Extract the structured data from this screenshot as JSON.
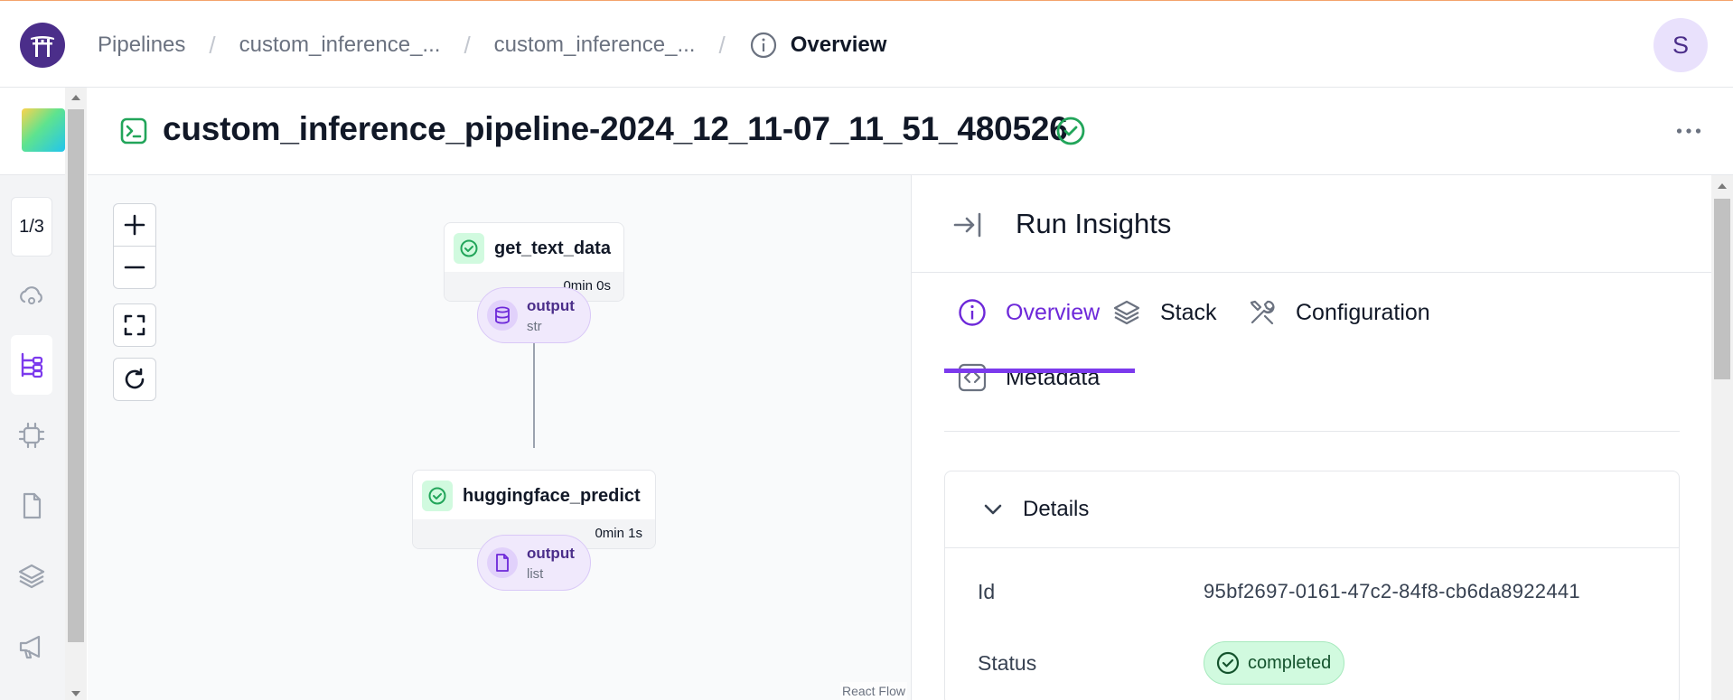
{
  "header": {
    "breadcrumbs": [
      "Pipelines",
      "custom_inference_...",
      "custom_inference_..."
    ],
    "current": "Overview",
    "avatar_initial": "S"
  },
  "rail": {
    "counter": "1/3",
    "icons": [
      "cloud-icon",
      "pipeline-icon",
      "chip-icon",
      "document-icon",
      "stack-icon",
      "megaphone-icon"
    ]
  },
  "run": {
    "title": "custom_inference_pipeline-2024_12_11-07_11_51_480526",
    "status": "completed"
  },
  "dag": {
    "steps": [
      {
        "name": "get_text_data",
        "duration": "0min 0s"
      },
      {
        "name": "huggingface_predict",
        "duration": "0min 1s"
      }
    ],
    "artifacts": [
      {
        "name": "output",
        "type": "str"
      },
      {
        "name": "output",
        "type": "list"
      }
    ],
    "attribution": "React Flow"
  },
  "panel": {
    "title": "Run Insights",
    "tabs": [
      "Overview",
      "Stack",
      "Configuration",
      "Metadata"
    ],
    "active_tab": "Overview",
    "details": {
      "title": "Details",
      "id_label": "Id",
      "id_value": "95bf2697-0161-47c2-84f8-cb6da8922441",
      "status_label": "Status",
      "status_value": "completed"
    }
  },
  "colors": {
    "accent": "#7c3aed",
    "brand": "#4b2e8a",
    "success": "#22a55a",
    "top_accent": "#f4a36c"
  }
}
